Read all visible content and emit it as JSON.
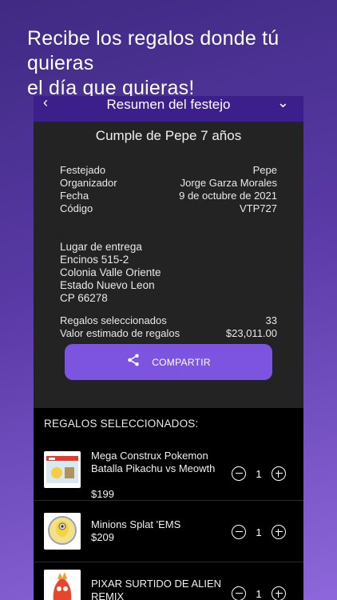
{
  "promo": {
    "line1": "Recibe los regalos donde tú quieras",
    "line2": "el día que quieras!"
  },
  "appbar": {
    "title": "Resumen del festejo"
  },
  "event": {
    "title": "Cumple de Pepe 7 años",
    "details": [
      {
        "label": "Festejado",
        "value": "Pepe"
      },
      {
        "label": "Organizador",
        "value": "Jorge Garza Morales"
      },
      {
        "label": "Fecha",
        "value": "9 de octubre de 2021"
      },
      {
        "label": "Código",
        "value": "VTP727"
      }
    ],
    "address": [
      "Lugar de entrega",
      "Encinos 515-2",
      "Colonia Valle Oriente",
      "Estado Nuevo Leon",
      "CP 66278"
    ],
    "stats": [
      {
        "label": "Regalos seleccionados",
        "value": "33"
      },
      {
        "label": "Valor estimado de regalos",
        "value": "$23,011.00"
      }
    ],
    "share_label": "COMPARTIR"
  },
  "selected": {
    "header": "REGALOS SELECCIONADOS:",
    "items": [
      {
        "name": "Mega Construx Pokemon Batalla Pikachu vs Meowth",
        "price": "$199",
        "qty": "1"
      },
      {
        "name": "Minions Splat 'EMS",
        "price": "$209",
        "qty": "1"
      },
      {
        "name": "PIXAR SURTIDO DE ALIEN REMIX",
        "price": "",
        "qty": "1"
      }
    ]
  },
  "colors": {
    "accent": "#7c54e0",
    "appbar": "#3c1f8a"
  }
}
